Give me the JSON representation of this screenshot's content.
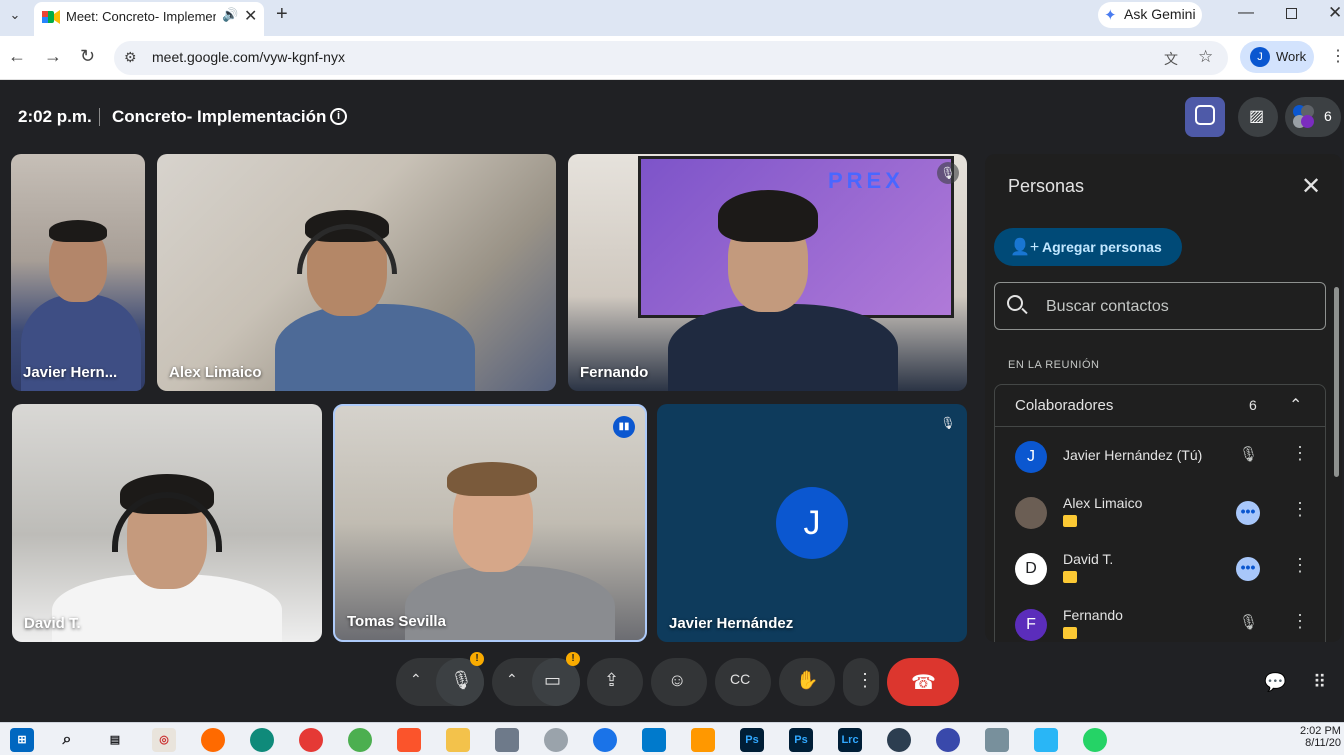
{
  "browser": {
    "tab_title": "Meet: Concreto- Implementación",
    "ask_gemini": "Ask Gemini",
    "url": "meet.google.com/vyw-kgnf-nyx",
    "profile_initial": "J",
    "profile_name": "Work"
  },
  "meeting": {
    "time": "2:02 p.m.",
    "name": "Concreto- Implementación",
    "participant_count": "6"
  },
  "tiles": [
    {
      "name": "Javier Hern..."
    },
    {
      "name": "Alex Limaico"
    },
    {
      "name": "Fernando"
    },
    {
      "name": "David T."
    },
    {
      "name": "Tomas Sevilla"
    },
    {
      "name": "Javier Hernández",
      "initial": "J"
    }
  ],
  "fernando_tile_logo": "PREX",
  "people_panel": {
    "title": "Personas",
    "add_label": "Agregar personas",
    "search_placeholder": "Buscar contactos",
    "section_label": "EN LA REUNIÓN",
    "group_title": "Colaboradores",
    "group_count": "6",
    "participants": [
      {
        "name": "Javier Hernández (Tú)",
        "initial": "J",
        "avatar_color": "#0b57d0"
      },
      {
        "name": "Alex Limaico",
        "initial": "",
        "avatar_color": "#6b5e54"
      },
      {
        "name": "David T.",
        "initial": "",
        "avatar_color": "#ffffff"
      },
      {
        "name": "Fernando",
        "initial": "F",
        "avatar_color": "#5b2dbb"
      }
    ]
  },
  "taskbar": {
    "time": "2:02 PM",
    "date": "8/11/20"
  },
  "colors": {
    "meet_bg": "#202124",
    "end_call": "#dc362e",
    "accent": "#0b57d0",
    "warning": "#f9ab00"
  }
}
